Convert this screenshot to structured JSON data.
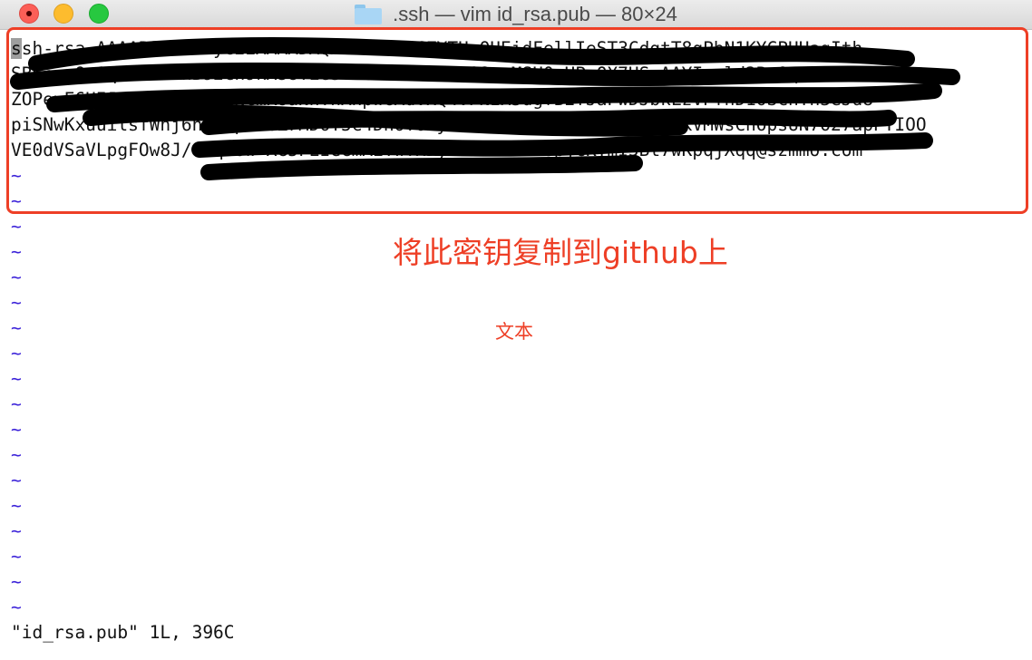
{
  "window": {
    "title": ".ssh — vim id_rsa.pub — 80×24"
  },
  "terminal": {
    "lines": [
      "ssh-rsa AAAAB3NzaC1yc2EAAAADAQABAAABAQCZYTUaQUEidFellIeST3CdgtT8qPbN1KYCPUHagIth",
      "SB6ceeQm9qmR7vTIhB92Cn9kXs8TEe3vfGFr0bP1x7cS8sqMSU0pHPnQX7HSoAAYIxyld2Bu0qZkO+",
      "ZOPeyE6UIJaSMIhnWIqp2NCmK8aNnYhAnpwGAdVxQ4VPNzM5dgfB2fJaPwDJbkLzVPfnD1OSChTn3eJd8",
      "piSNwKxuuilsfWnj6nqIFpHWeZrMDOT5C4DnOY0Hy2m2UnOsXVaaHCkoj6TTzX8kVMWsChOpsUN7O27apPTIOO",
      "VE0dVSaVLpgFOw8J/tPqYOw+XG5FEIeGmAiYwYxDyRTRdfCzMKUpjcKYmI5Bt7wKpqjXqq@szmmo.com"
    ],
    "empty_line_marker": "~",
    "empty_line_count": 18
  },
  "annotation": {
    "main": "将此密钥复制到github上",
    "label": "文本"
  },
  "status_line": "\"id_rsa.pub\" 1L, 396C",
  "colors": {
    "highlight": "#ee3f26",
    "tilde": "#3b22d9"
  }
}
